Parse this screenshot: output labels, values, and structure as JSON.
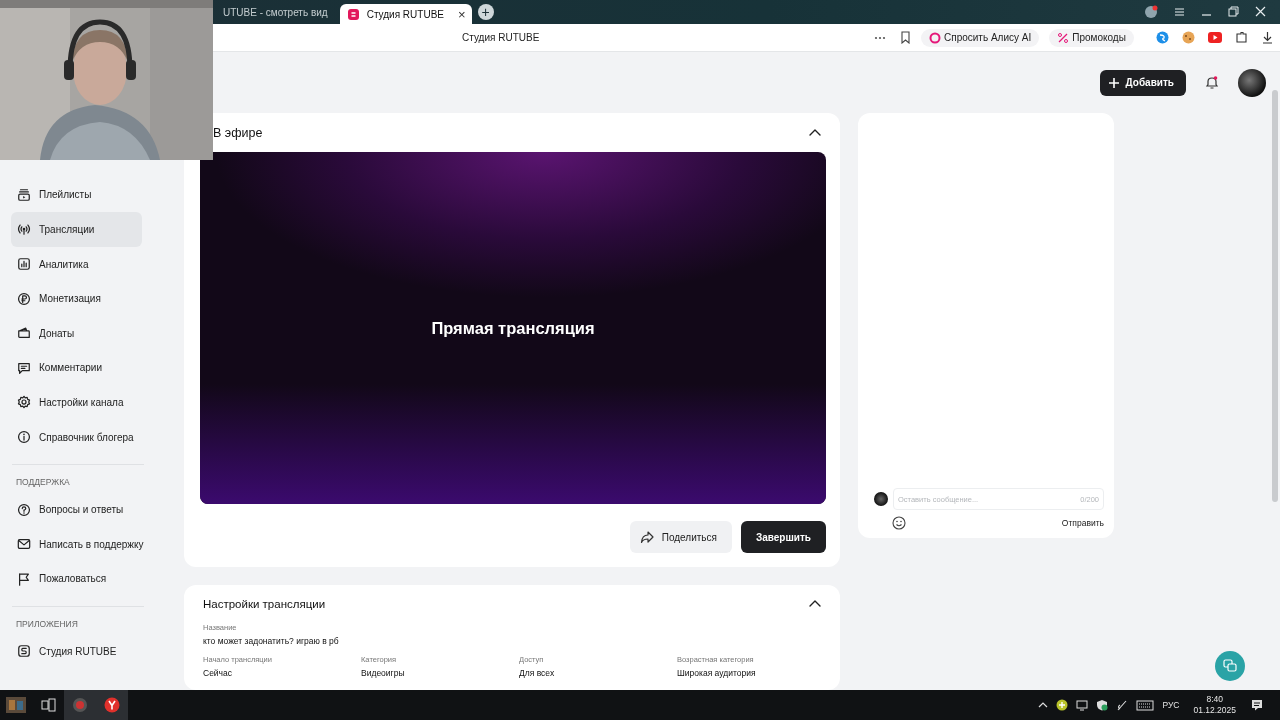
{
  "browser": {
    "tabs": [
      {
        "title": "UTUBE - смотреть вид",
        "selected": false
      },
      {
        "title": "Студия RUTUBE",
        "selected": true
      }
    ],
    "close": "×",
    "new_tab": "+",
    "page_title": "Студия RUTUBE",
    "alice": "Спросить Алису AI",
    "promo": "Промокоды"
  },
  "header": {
    "add_button": "Добавить"
  },
  "sidebar": {
    "sections": [
      {
        "items": [
          {
            "label": "Плейлисты",
            "selected": false
          },
          {
            "label": "Трансляции",
            "selected": true
          },
          {
            "label": "Аналитика",
            "selected": false
          },
          {
            "label": "Монетизация",
            "selected": false
          },
          {
            "label": "Донаты",
            "selected": false
          },
          {
            "label": "Комментарии",
            "selected": false
          },
          {
            "label": "Настройки канала",
            "selected": false
          },
          {
            "label": "Справочник блогера",
            "selected": false
          }
        ]
      },
      {
        "heading": "ПОДДЕРЖКА",
        "items": [
          {
            "label": "Вопросы и ответы",
            "selected": false
          },
          {
            "label": "Написать в поддержку",
            "selected": false
          },
          {
            "label": "Пожаловаться",
            "selected": false
          }
        ]
      },
      {
        "heading": "ПРИЛОЖЕНИЯ",
        "items": [
          {
            "label": "Студия RUTUBE",
            "selected": false
          }
        ]
      }
    ]
  },
  "live": {
    "title": "В эфире",
    "expanded": true,
    "player_text": "Прямая трансляция",
    "buttons": [
      {
        "label": "Поделиться",
        "kind": "secondary"
      },
      {
        "label": "Завершить",
        "kind": "primary"
      }
    ]
  },
  "chat": {
    "placeholder": "Оставить сообщение...",
    "counter": "0/200",
    "send": "Отправить"
  },
  "settings": {
    "title": "Настройки трансляции",
    "expanded": true,
    "fields": [
      {
        "label": "Название",
        "value": "кто может задонатить? играю в рб"
      },
      {
        "label": "Начало трансляции",
        "value": "Сейчас"
      },
      {
        "label": "Категория",
        "value": "Видеоигры"
      },
      {
        "label": "Доступ",
        "value": "Для всех"
      },
      {
        "label": "Возрастная категория",
        "value": "Широкая аудитория"
      }
    ]
  },
  "taskbar": {
    "language": "РУС",
    "time": "8:40",
    "date": "01.12.2025"
  }
}
